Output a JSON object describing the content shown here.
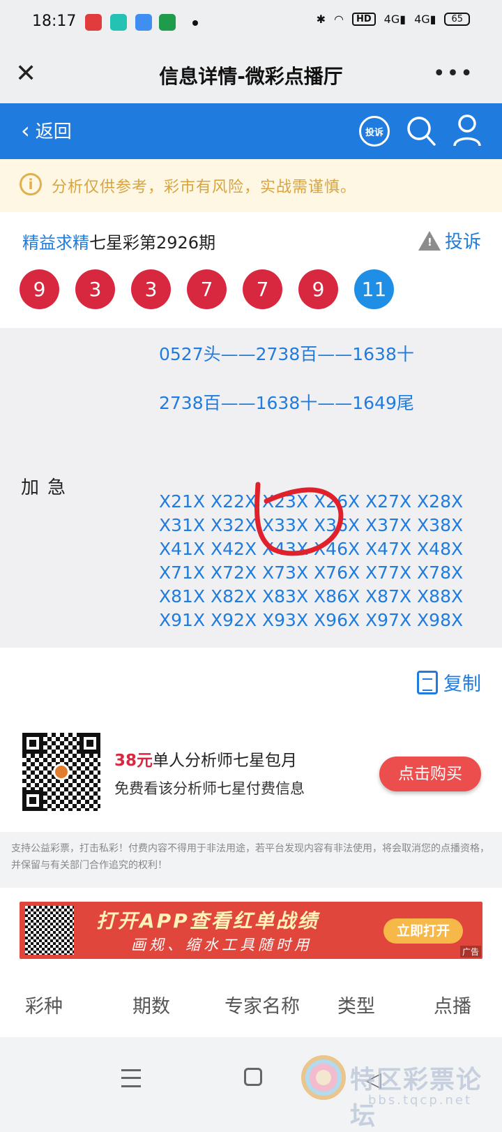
{
  "status_bar": {
    "time": "18:17",
    "hd": "HD",
    "net1": "4G",
    "net2": "4G",
    "battery": "65"
  },
  "title_bar": {
    "title": "信息详情-微彩点播厅",
    "close_icon": "close-icon",
    "more_icon": "more-icon"
  },
  "nav": {
    "back_label": "返回",
    "complain_badge": "投诉"
  },
  "notice": {
    "text": "分析仅供参考，彩市有风险，实战需谨慎。"
  },
  "issue": {
    "expert_name": "精益求精",
    "lottery": "七星彩第2926期",
    "report_label": "投诉",
    "balls": [
      "9",
      "3",
      "3",
      "7",
      "7",
      "9"
    ],
    "special_ball": "11"
  },
  "content": {
    "line1": "0527头——2738百——1638十",
    "line2": "2738百——1638十——1649尾",
    "label": "加急",
    "grid_rows": [
      "X21X X22X X23X X26X X27X X28X",
      "X31X X32X X33X X36X X37X X38X",
      "X41X X42X X43X X46X X47X X48X",
      "X71X X72X X73X X76X X77X X78X",
      "X81X X82X X83X X86X X87X X88X",
      "X91X X92X X93X X96X X97X X98X"
    ]
  },
  "copy_label": "复制",
  "promo": {
    "price": "38元",
    "title_rest": "单人分析师七星包月",
    "subtitle": "免费看该分析师七星付费信息",
    "buy_button": "点击购买"
  },
  "disclaimer": "支持公益彩票，打击私彩！付费内容不得用于非法用途，若平台发现内容有非法使用，将会取消您的点播资格，并保留与有关部门合作追究的权利！",
  "ad": {
    "headline": "打开APP查看红单战绩",
    "subline": "画规、缩水工具随时用",
    "open_button": "立即打开",
    "ad_tag": "广告"
  },
  "tabs": [
    "彩种",
    "期数",
    "专家名称",
    "类型",
    "点播"
  ],
  "watermark": {
    "text": "特区彩票论坛",
    "url": "bbs.tqcp.net"
  },
  "colors": {
    "primary": "#1f7cde",
    "ball_red": "#d8283f",
    "ball_blue": "#1f8fe6",
    "warning": "#d9a43f",
    "buy_button": "#ec4e4e"
  }
}
